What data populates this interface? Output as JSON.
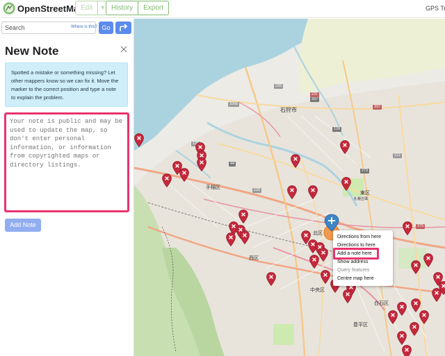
{
  "header": {
    "brand": "OpenStreetMap",
    "tabs": [
      {
        "label": "Edit",
        "disabled": true
      },
      {
        "label": "▾",
        "disabled": true
      }
    ],
    "nav": [
      "History",
      "Export"
    ],
    "gps_link": "GPS Tra"
  },
  "sidebar": {
    "search": {
      "placeholder": "Search",
      "where_is_this": "Where is this?",
      "go_label": "Go"
    },
    "note": {
      "title": "New Note",
      "help_text": "Spotted a mistake or something missing? Let other mappers know so we can fix it. Move the marker to the correct position and type a note to explain the problem.",
      "textarea_placeholder": "Your note is public and may be used to update the map, so don't enter personal information, or information from copyrighted maps or directory listings.",
      "add_note_label": "Add Note"
    }
  },
  "map": {
    "labels": {
      "city_ishikari": "石狩市",
      "ward_teine": "手稲区",
      "ward_nishi": "西区",
      "ward_kita": "北区",
      "ward_chuo": "中央区",
      "ward_shiroishi": "白石区",
      "ward_toyohira": "豊平区",
      "ward_higashi": "東区",
      "park_name": "札幌丘珠"
    },
    "shields": {
      "s225": "225",
      "s231_337": "231\n337",
      "s231": "231",
      "s337": "337",
      "s1066": "1066",
      "s128": "128",
      "s44": "44",
      "s273": "273",
      "s112": "112",
      "s125": "125",
      "s275": "275",
      "s27": "27"
    },
    "context_menu": [
      {
        "label": "Directions from here",
        "disabled": false
      },
      {
        "label": "Directions to here",
        "disabled": false
      },
      {
        "label": "Add a note here",
        "disabled": false
      },
      {
        "label": "Show address",
        "disabled": false
      },
      {
        "label": "Query features",
        "disabled": true
      },
      {
        "label": "Centre map here",
        "disabled": false
      }
    ]
  },
  "colors": {
    "highlight": "#e8336d",
    "osm_green": "#7ebc6f",
    "button_blue": "#5b8bec",
    "note_marker_red": "#c6283b",
    "help_bg": "#cfeefa"
  }
}
